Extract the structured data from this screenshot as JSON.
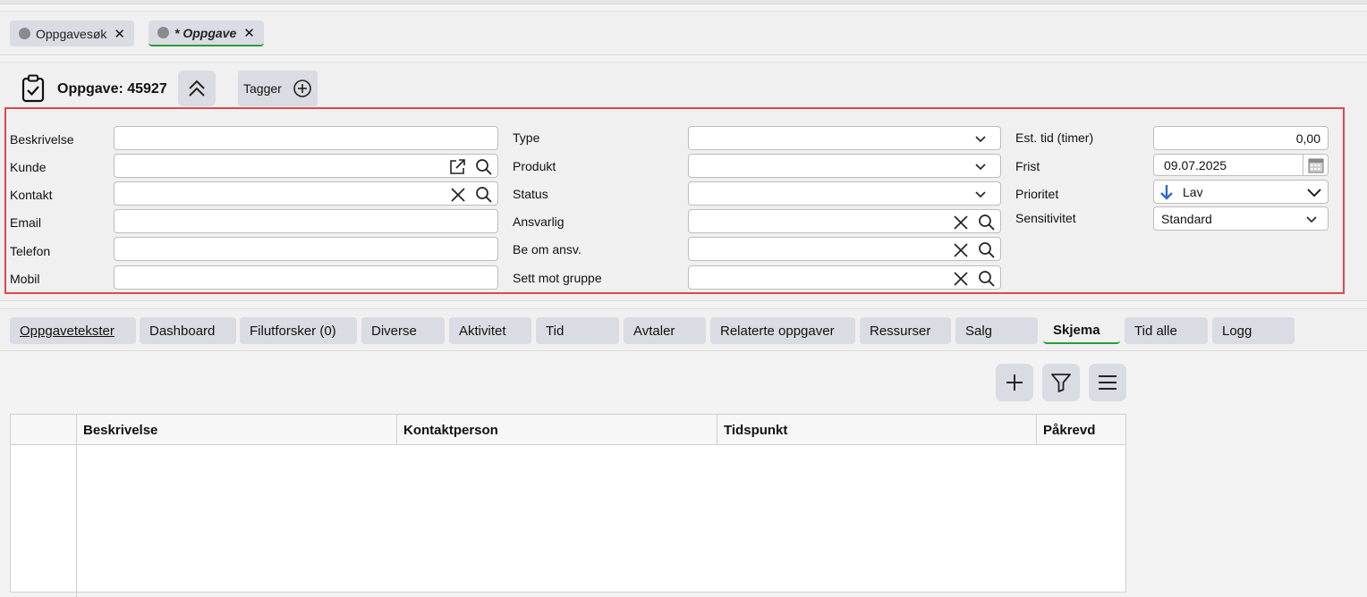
{
  "doc_tabs": [
    {
      "label": "Oppgavesøk",
      "active": false
    },
    {
      "label": "* Oppgave",
      "active": true
    }
  ],
  "header": {
    "title": "Oppgave: 45927",
    "tags_label": "Tagger"
  },
  "form": {
    "col1": {
      "beskrivelse_label": "Beskrivelse",
      "beskrivelse_value": "",
      "kunde_label": "Kunde",
      "kunde_value": "",
      "kontakt_label": "Kontakt",
      "kontakt_value": "",
      "email_label": "Email",
      "email_value": "",
      "telefon_label": "Telefon",
      "telefon_value": "",
      "mobil_label": "Mobil",
      "mobil_value": ""
    },
    "col2": {
      "type_label": "Type",
      "type_value": "",
      "produkt_label": "Produkt",
      "produkt_value": "",
      "status_label": "Status",
      "status_value": "",
      "ansvarlig_label": "Ansvarlig",
      "ansvarlig_value": "",
      "be_om_ansv_label": "Be om ansv.",
      "be_om_ansv_value": "",
      "sett_mot_gruppe_label": "Sett mot gruppe",
      "sett_mot_gruppe_value": ""
    },
    "col3": {
      "est_tid_label": "Est. tid (timer)",
      "est_tid_value": "0,00",
      "frist_label": "Frist",
      "frist_value": "09.07.2025",
      "prioritet_label": "Prioritet",
      "prioritet_value": "Lav",
      "sensitivitet_label": "Sensitivitet",
      "sensitivitet_value": "Standard"
    }
  },
  "sub_tabs": [
    {
      "label": "Oppgavetekster",
      "active": false
    },
    {
      "label": "Dashboard",
      "active": false
    },
    {
      "label": "Filutforsker (0)",
      "active": false
    },
    {
      "label": "Diverse",
      "active": false
    },
    {
      "label": "Aktivitet",
      "active": false
    },
    {
      "label": "Tid",
      "active": false
    },
    {
      "label": "Avtaler",
      "active": false
    },
    {
      "label": "Relaterte oppgaver",
      "active": false
    },
    {
      "label": "Ressurser",
      "active": false
    },
    {
      "label": "Salg",
      "active": false
    },
    {
      "label": "Skjema",
      "active": true
    },
    {
      "label": "Tid alle",
      "active": false
    },
    {
      "label": "Logg",
      "active": false
    }
  ],
  "toolbar": {
    "icons": [
      "plus-icon",
      "filter-icon",
      "menu-icon"
    ]
  },
  "grid": {
    "columns": [
      "",
      "Beskrivelse",
      "Kontaktperson",
      "Tidspunkt",
      "Påkrevd"
    ],
    "rows": []
  },
  "colors": {
    "accent_green": "#2a9d3a",
    "highlight_red": "#e0474c",
    "priority_arrow": "#2f6fc4"
  }
}
